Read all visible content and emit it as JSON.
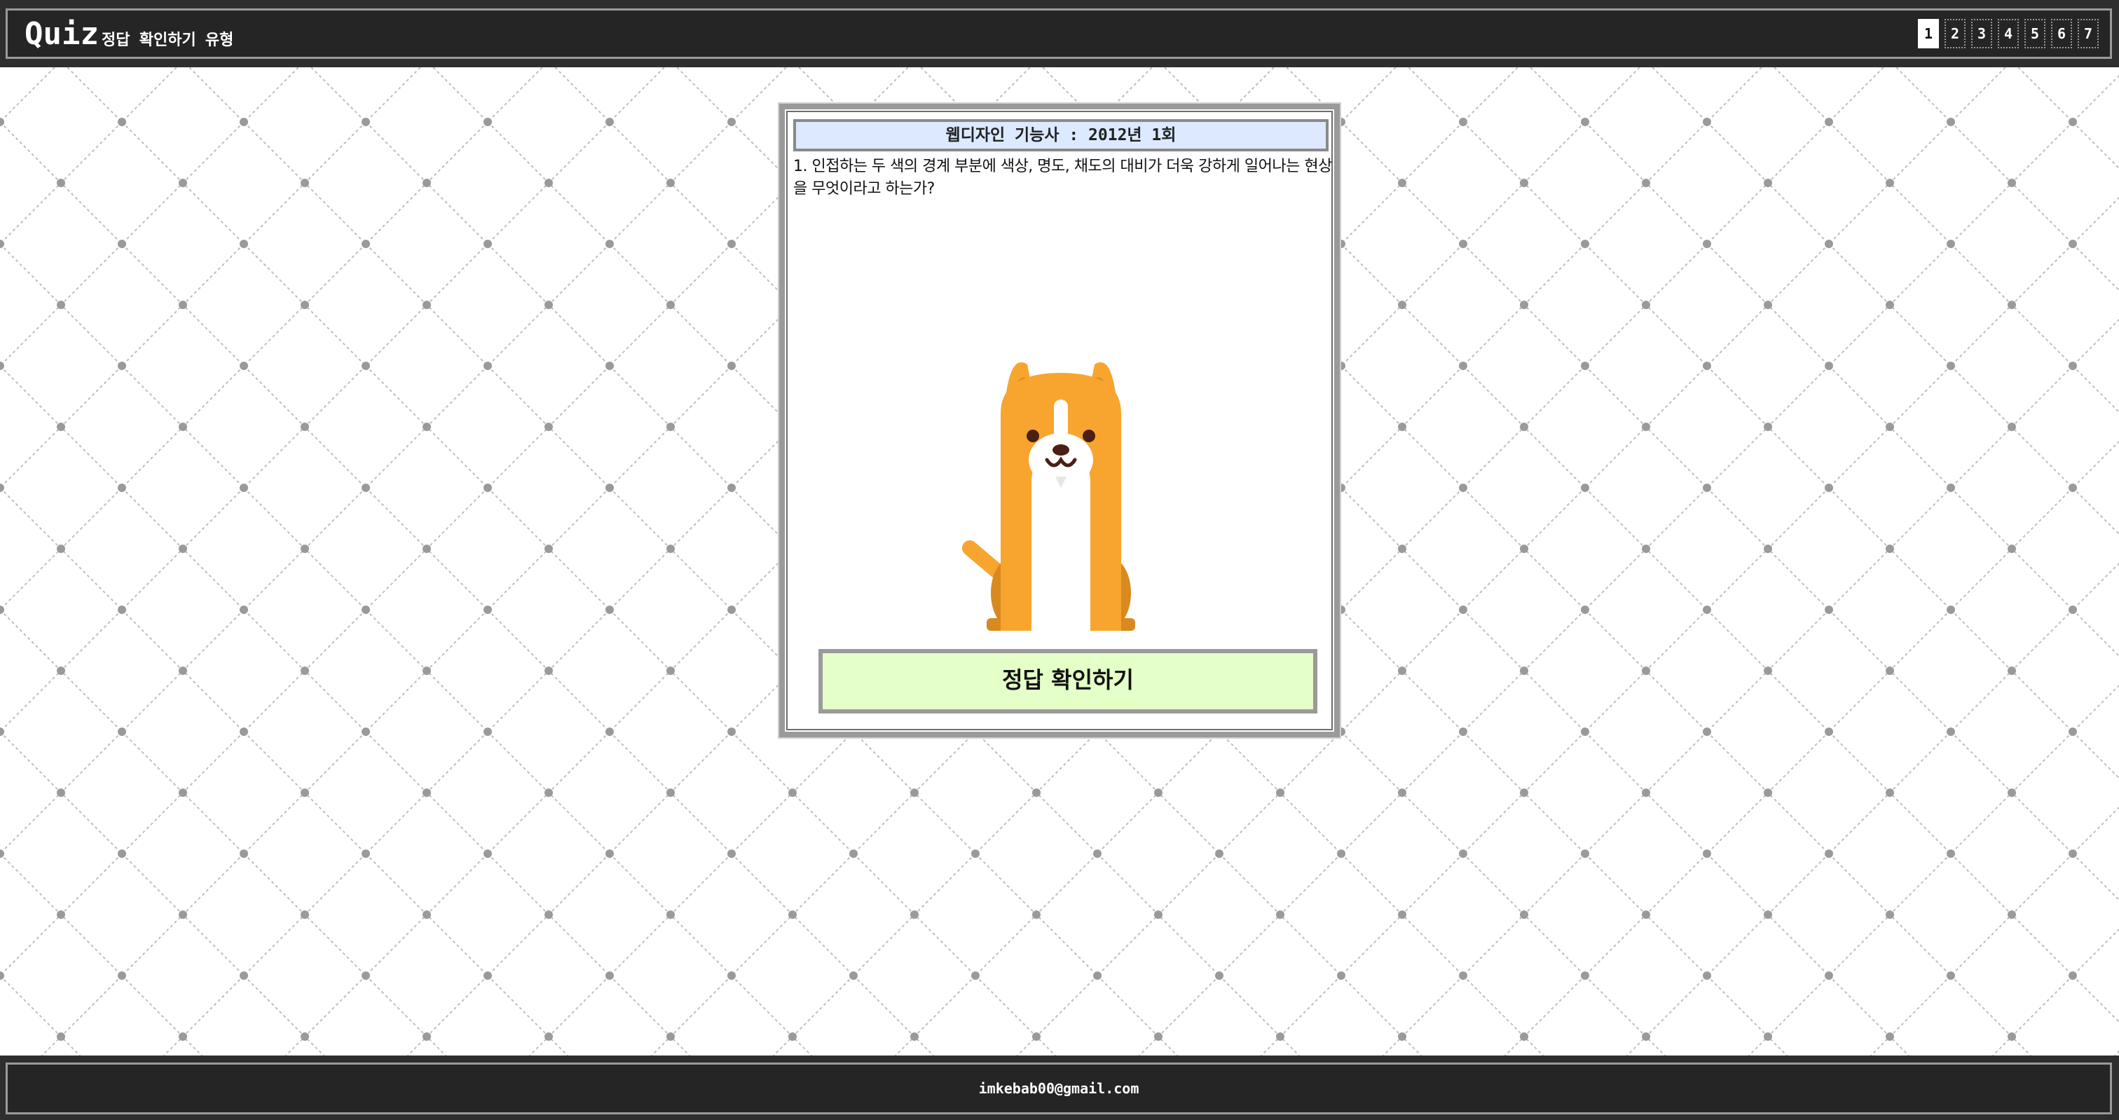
{
  "header": {
    "logo": "Quiz",
    "subtitle": "정답 확인하기 유형",
    "pages": [
      "1",
      "2",
      "3",
      "4",
      "5",
      "6",
      "7"
    ],
    "active_page": "1"
  },
  "quiz": {
    "title": "웹디자인 기능사 : 2012년 1회",
    "question": "1. 인접하는 두 색의 경계 부분에 색상, 명도, 채도의 대비가 더욱 강하게 일어나는 현상을 무엇이라고 하는가?",
    "mascot_icon": "dog-icon",
    "answer_button": "정답 확인하기"
  },
  "footer": {
    "email": "imkebab00@gmail.com"
  },
  "colors": {
    "header_bg": "#2e2e2e",
    "title_bg": "#dce9ff",
    "answer_bg": "#e4ffc7",
    "dog_orange": "#f7a52e",
    "dog_dark": "#d98a1e"
  }
}
